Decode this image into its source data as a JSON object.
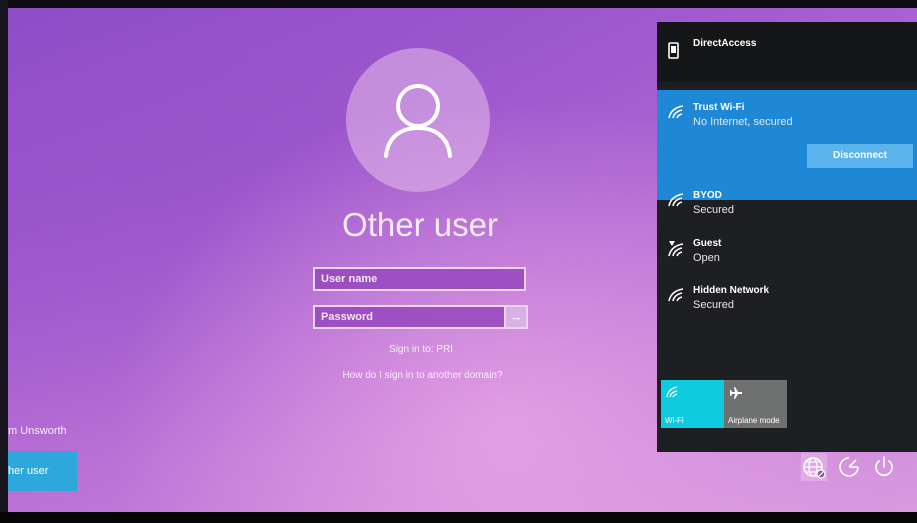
{
  "login": {
    "title": "Other user",
    "username_placeholder": "User name",
    "password_placeholder": "Password",
    "submit_glyph": "→",
    "sign_in_to": "Sign in to: PRI",
    "other_domain_link": "How do I sign in to another domain?"
  },
  "left_panel": {
    "partial_user_name": "m Unsworth",
    "other_user_tile": "her user"
  },
  "network_flyout": {
    "direct_access": {
      "name": "DirectAccess",
      "icon": "phone-icon"
    },
    "networks": [
      {
        "name": "Trust Wi-Fi",
        "status": "No Internet, secured",
        "icon": "wifi-secured-icon"
      },
      {
        "name": "BYOD",
        "status": "Secured",
        "icon": "wifi-secured-icon"
      },
      {
        "name": "Guest",
        "status": "Open",
        "icon": "wifi-open-icon"
      },
      {
        "name": "Hidden Network",
        "status": "Secured",
        "icon": "wifi-secured-icon"
      }
    ],
    "disconnect_label": "Disconnect",
    "quick_actions": [
      {
        "label": "Wi-Fi",
        "icon": "wifi-icon",
        "color": "#0fcbe0"
      },
      {
        "label": "Airplane mode",
        "icon": "airplane-icon",
        "color": "#6f7070"
      }
    ],
    "accent": "#1e88d6"
  },
  "tray": {
    "icons": [
      "network-globe-icon",
      "ease-of-access-icon",
      "power-icon"
    ]
  }
}
